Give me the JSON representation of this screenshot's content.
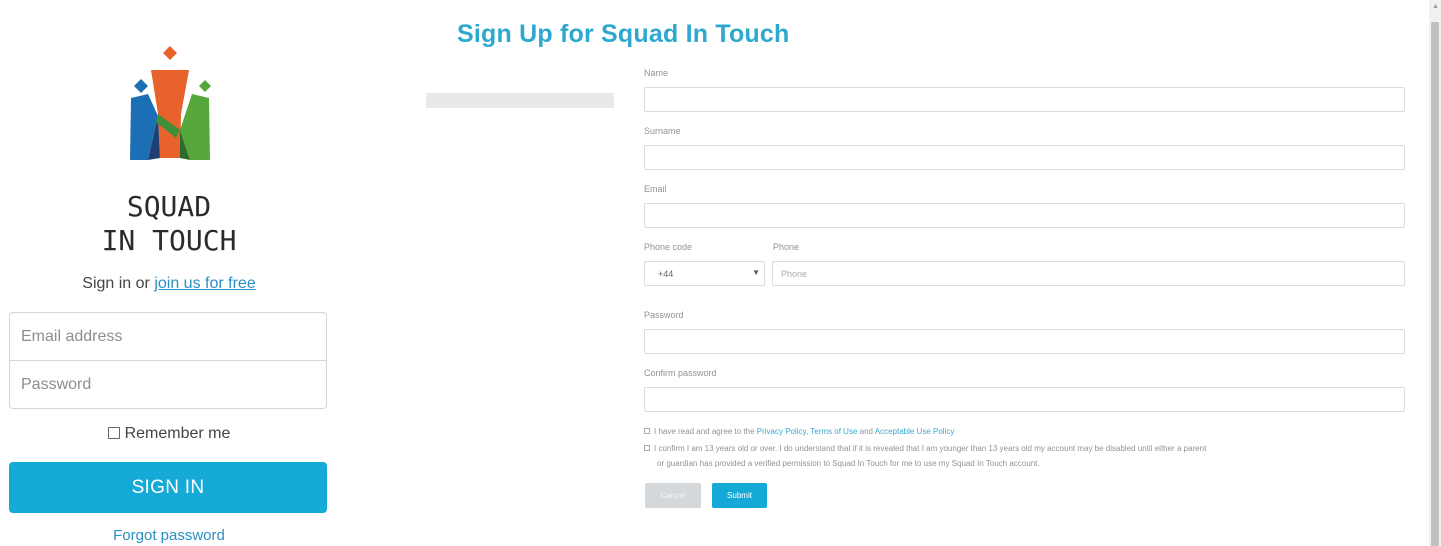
{
  "brand": {
    "line1": "SQUAD",
    "line2": "IN TOUCH"
  },
  "signin": {
    "prefix": "Sign in or ",
    "join_link": "join us for free",
    "email_placeholder": "Email address",
    "password_placeholder": "Password",
    "remember_label": "Remember me",
    "signin_button": "SIGN IN",
    "forgot_link": "Forgot password"
  },
  "signup": {
    "title": "Sign Up for Squad In Touch",
    "name_label": "Name",
    "surname_label": "Surname",
    "email_label": "Email",
    "phone_code_label": "Phone code",
    "phone_code_value": "+44",
    "phone_label": "Phone",
    "phone_placeholder": "Phone",
    "password_label": "Password",
    "confirm_label": "Confirm password",
    "agree_prefix": "I have read and agree to the ",
    "privacy_link": "Privacy Policy",
    "sep": ", ",
    "terms_link": "Terms of Use",
    "and": " and ",
    "aup_link": "Acceptable Use Policy",
    "confirm_age_text": "I confirm I am 13 years old or over. I do understand that if it is revealed that I am younger than 13 years old my account may be disabled until either a parent",
    "confirm_age_text2": "or guardian has provided a verified permission to Squad In Touch for me to use my Squad In Touch account.",
    "cancel_button": "Cancel",
    "submit_button": "Submit"
  },
  "colors": {
    "accent": "#14a9d6",
    "title": "#2ea8cf",
    "link": "#2a8fc1",
    "logo_orange": "#e8622c",
    "logo_blue": "#1d6fb5",
    "logo_dark_blue": "#1f3f73",
    "logo_green": "#56a83a",
    "logo_dark_green": "#2e6b2d"
  }
}
